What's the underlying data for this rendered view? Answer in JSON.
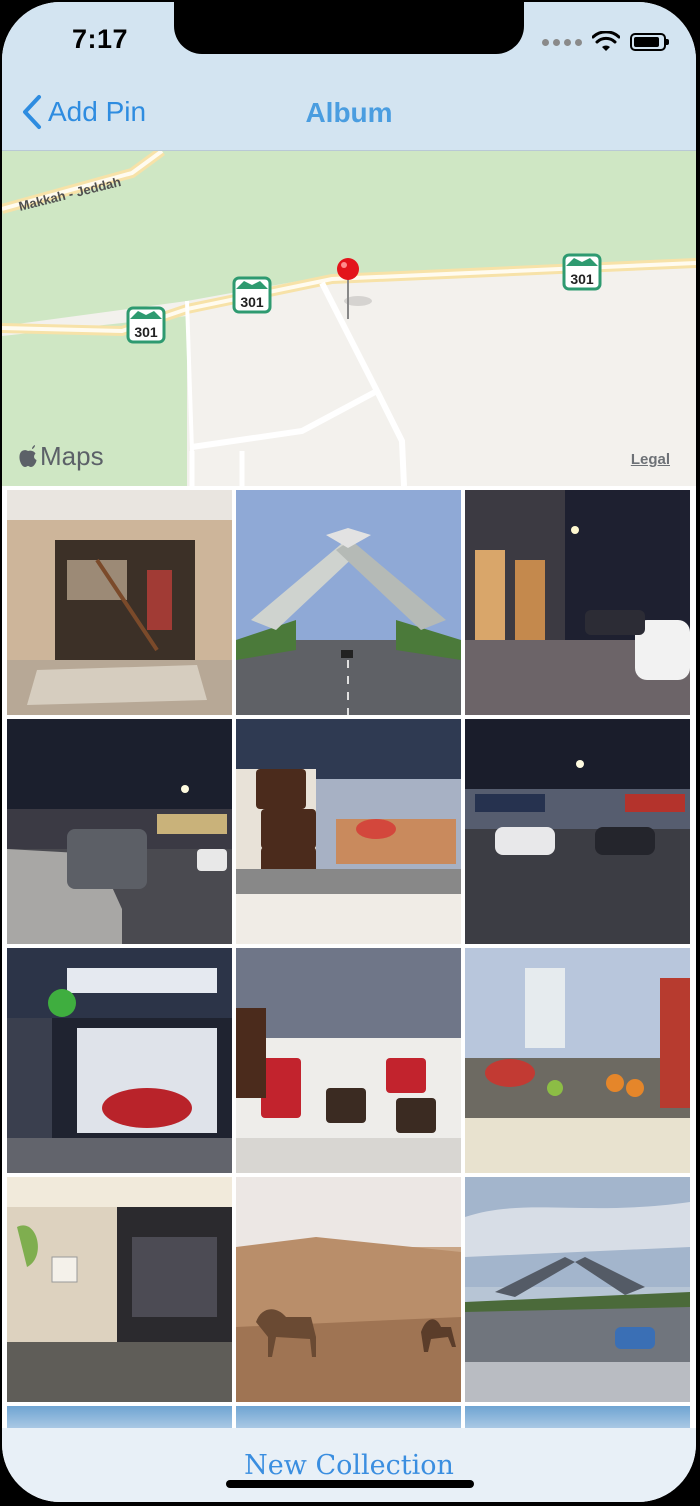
{
  "status_bar": {
    "time": "7:17"
  },
  "nav": {
    "back_label": "Add Pin",
    "title": "Album"
  },
  "map": {
    "road_label": "Makkah - Jeddah",
    "route_shields": [
      "301",
      "301",
      "301"
    ],
    "attribution": "Maps",
    "legal_label": "Legal"
  },
  "photos": [
    {
      "label": "photo-1"
    },
    {
      "label": "photo-2"
    },
    {
      "label": "photo-3"
    },
    {
      "label": "photo-4"
    },
    {
      "label": "photo-5"
    },
    {
      "label": "photo-6"
    },
    {
      "label": "photo-7"
    },
    {
      "label": "photo-8"
    },
    {
      "label": "photo-9"
    },
    {
      "label": "photo-10"
    },
    {
      "label": "photo-11"
    },
    {
      "label": "photo-12"
    }
  ],
  "toolbar": {
    "new_collection_label": "New Collection"
  },
  "colors": {
    "accent": "#2e8ce0",
    "nav_bg": "#d3e4f1",
    "map_park": "#cfe7c4"
  }
}
